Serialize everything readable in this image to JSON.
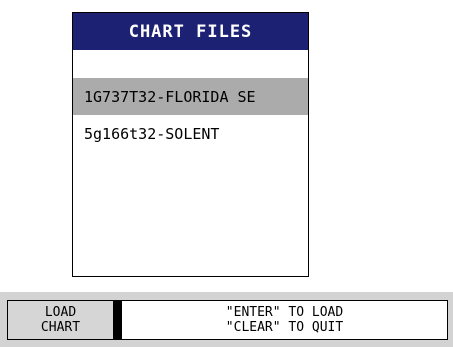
{
  "panel": {
    "title": "CHART FILES",
    "files": [
      {
        "label": "1G737T32-FLORIDA SE",
        "selected": true
      },
      {
        "label": "5g166t32-SOLENT",
        "selected": false
      }
    ]
  },
  "bottom": {
    "button": {
      "line1": "LOAD",
      "line2": "CHART"
    },
    "instructions": {
      "line1": "\"ENTER\" TO LOAD",
      "line2": "\"CLEAR\" TO QUIT"
    }
  },
  "colors": {
    "title_bg": "#1d2173",
    "selection_bg": "#ababab",
    "bar_bg": "#d3d3d3"
  }
}
